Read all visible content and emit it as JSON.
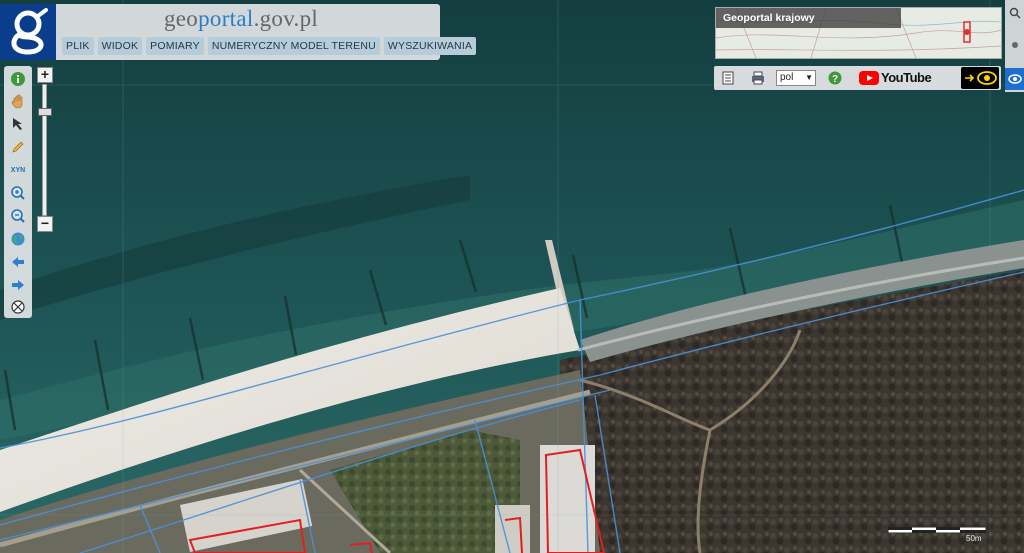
{
  "header": {
    "title_prefix": "geo",
    "title_accent": "portal",
    "title_suffix": ".gov.pl",
    "menu": [
      "PLIK",
      "WIDOK",
      "POMIARY",
      "NUMERYCZNY MODEL TERENU",
      "WYSZUKIWANIA"
    ]
  },
  "toolbar": {
    "tools": [
      "info-icon",
      "pan-hand-icon",
      "select-arrow-icon",
      "pencil-icon",
      "xyz-coordinates-icon",
      "zoom-in-icon",
      "zoom-out-icon",
      "globe-icon",
      "back-arrow-icon",
      "forward-arrow-icon",
      "compass-icon"
    ],
    "xyz_label": "XYN"
  },
  "zoom": {
    "in_label": "+",
    "out_label": "−",
    "level": 0.2
  },
  "overview": {
    "label": "Geoportal krajowy"
  },
  "topbar": {
    "language": "pol",
    "youtube_label": "YouTube"
  },
  "scale": {
    "label": "50m"
  },
  "colors": {
    "sea": "#1f4f50",
    "beach": "#e6e2da",
    "forest": "#3a3630",
    "boundary": "#4a90d9",
    "building_outline": "#e02020",
    "logo": "#0a3e8c"
  }
}
